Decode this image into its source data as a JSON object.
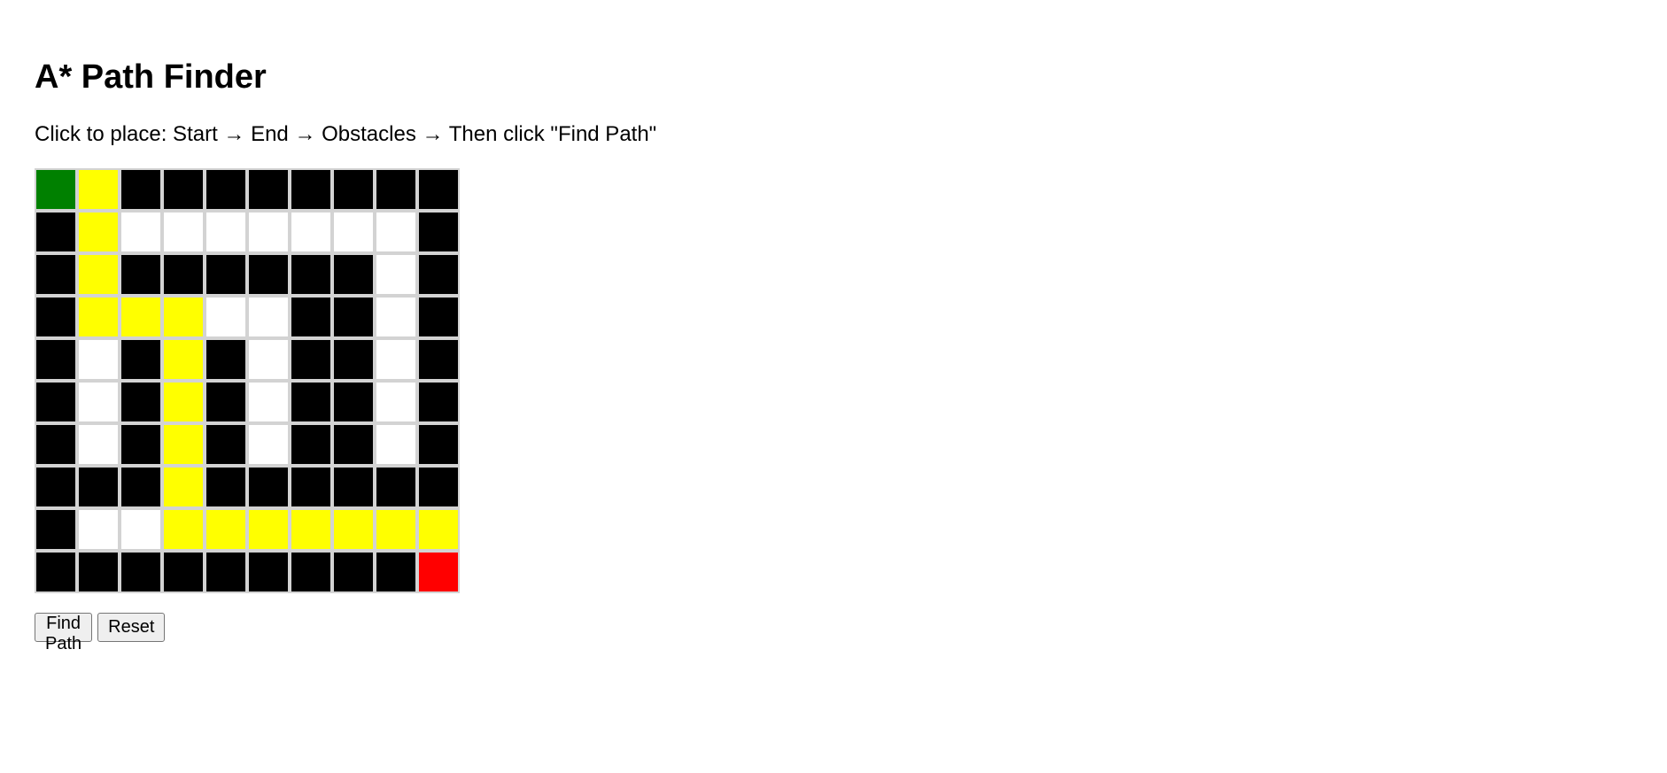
{
  "title": "A* Path Finder",
  "instructions": "Click to place: Start → End → Obstacles → Then click \"Find Path\"",
  "buttons": {
    "find_path": "Find Path",
    "reset": "Reset"
  },
  "colors": {
    "S": "#008000",
    "E": "#ff0000",
    "W": "#000000",
    "P": "#ffff00",
    ".": "#ffffff"
  },
  "cell_names": {
    "S": "grid-cell-start",
    "E": "grid-cell-end",
    "W": "grid-cell-obstacle",
    "P": "grid-cell-path",
    ".": "grid-cell-empty"
  },
  "grid": [
    "SPWWWWWWWW",
    "WP.......W",
    "WPWWWWWW.W",
    "WPPP..WW.W",
    "W.WPW.WW.W",
    "W.WPW.WW.W",
    "W.WPW.WW.W",
    "WWWPWWWWWW",
    "W..PPPPPPP",
    "WWWWWWWWWE"
  ]
}
